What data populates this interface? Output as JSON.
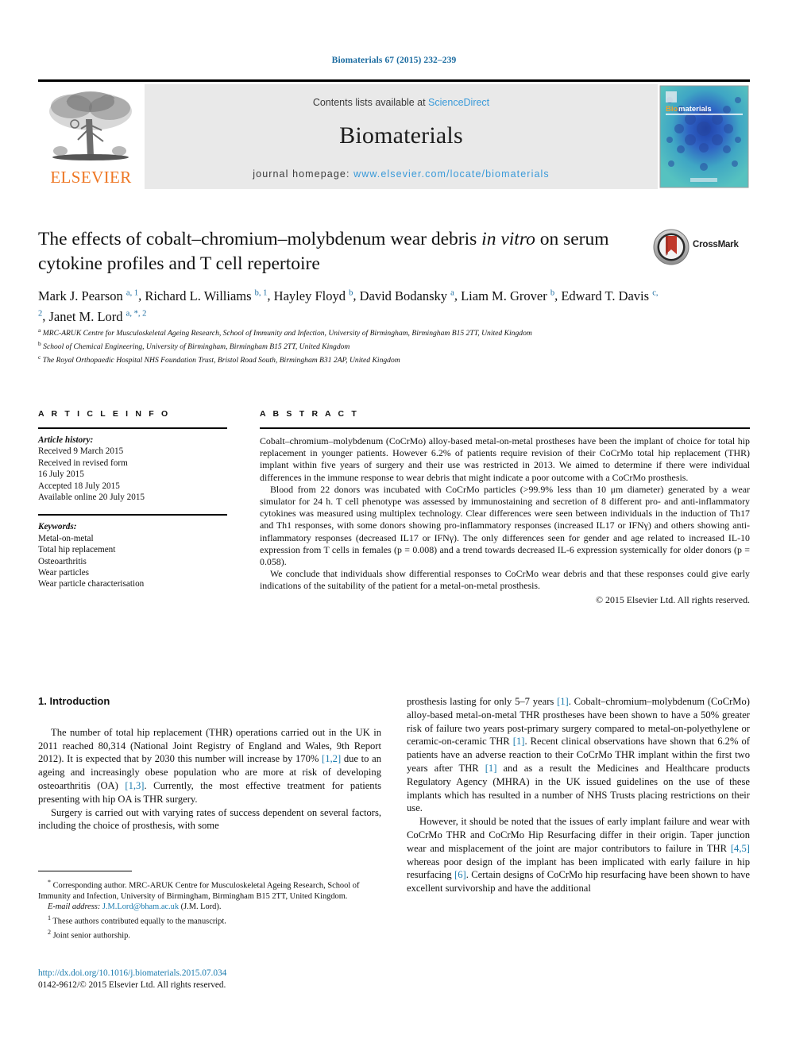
{
  "running_head": "Biomaterials 67 (2015) 232–239",
  "masthead": {
    "publisher_name": "ELSEVIER",
    "contents_prefix": "Contents lists available at ",
    "contents_link": "ScienceDirect",
    "journal_name": "Biomaterials",
    "homepage_prefix": "journal homepage: ",
    "homepage_url": "www.elsevier.com/locate/biomaterials",
    "cover_title_bio": "Bio",
    "cover_title_materials": "materials"
  },
  "article": {
    "title_line1_a": "The effects of cobalt",
    "title_full": "The effects of cobalt–chromium–molybdenum wear debris in vitro on serum cytokine profiles and T cell repertoire",
    "title_part1": "The effects of cobalt–chromium–molybdenum wear debris ",
    "title_italic": "in vitro",
    "title_part2": " on serum cytokine profiles and T cell repertoire",
    "crossmark_label": "CrossMark",
    "authors": [
      {
        "name": "Mark J. Pearson",
        "marks": "a, 1"
      },
      {
        "name": "Richard L. Williams",
        "marks": "b, 1"
      },
      {
        "name": "Hayley Floyd",
        "marks": "b"
      },
      {
        "name": "David Bodansky",
        "marks": "a"
      },
      {
        "name": "Liam M. Grover",
        "marks": "b"
      },
      {
        "name": "Edward T. Davis",
        "marks": "c, 2"
      },
      {
        "name": "Janet M. Lord",
        "marks": "a, *, 2"
      }
    ],
    "affiliations": [
      {
        "mark": "a",
        "text": "MRC-ARUK Centre for Musculoskeletal Ageing Research, School of Immunity and Infection, University of Birmingham, Birmingham B15 2TT, United Kingdom"
      },
      {
        "mark": "b",
        "text": "School of Chemical Engineering, University of Birmingham, Birmingham B15 2TT, United Kingdom"
      },
      {
        "mark": "c",
        "text": "The Royal Orthopaedic Hospital NHS Foundation Trust, Bristol Road South, Birmingham B31 2AP, United Kingdom"
      }
    ]
  },
  "article_info": {
    "heading": "A R T I C L E   I N F O",
    "history_label": "Article history:",
    "history": [
      "Received 9 March 2015",
      "Received in revised form",
      "16 July 2015",
      "Accepted 18 July 2015",
      "Available online 20 July 2015"
    ],
    "keywords_label": "Keywords:",
    "keywords": [
      "Metal-on-metal",
      "Total hip replacement",
      "Osteoarthritis",
      "Wear particles",
      "Wear particle characterisation"
    ]
  },
  "abstract": {
    "heading": "A B S T R A C T",
    "paragraphs": [
      "Cobalt–chromium–molybdenum (CoCrMo) alloy-based metal-on-metal prostheses have been the implant of choice for total hip replacement in younger patients. However 6.2% of patients require revision of their CoCrMo total hip replacement (THR) implant within five years of surgery and their use was restricted in 2013. We aimed to determine if there were individual differences in the immune response to wear debris that might indicate a poor outcome with a CoCrMo prosthesis.",
      "Blood from 22 donors was incubated with CoCrMo particles (>99.9% less than 10 μm diameter) generated by a wear simulator for 24 h. T cell phenotype was assessed by immunostaining and secretion of 8 different pro- and anti-inflammatory cytokines was measured using multiplex technology. Clear differences were seen between individuals in the induction of Th17 and Th1 responses, with some donors showing pro-inflammatory responses (increased IL17 or IFNγ) and others showing anti-inflammatory responses (decreased IL17 or IFNγ). The only differences seen for gender and age related to increased IL-10 expression from T cells in females (p = 0.008) and a trend towards decreased IL-6 expression systemically for older donors (p = 0.058).",
      "We conclude that individuals show differential responses to CoCrMo wear debris and that these responses could give early indications of the suitability of the patient for a metal-on-metal prosthesis."
    ],
    "copyright": "© 2015 Elsevier Ltd. All rights reserved."
  },
  "introduction": {
    "heading": "1.  Introduction",
    "left_paragraph_1_pre": "The number of total hip replacement (THR) operations carried out in the UK in 2011 reached 80,314 (National Joint Registry of England and Wales, 9th Report 2012). It is expected that by 2030 this number will increase by 170% ",
    "ref_1_2": "[1,2]",
    "left_paragraph_1_mid": " due to an ageing and increasingly obese population who are more at risk of developing osteoarthritis (OA) ",
    "ref_1_3": "[1,3]",
    "left_paragraph_1_post": ". Currently, the most effective treatment for patients presenting with hip OA is THR surgery.",
    "left_paragraph_2": "Surgery is carried out with varying rates of success dependent on several factors, including the choice of prosthesis, with some",
    "right_paragraph_1_pre": "prosthesis lasting for only 5–7 years ",
    "ref_1_a": "[1]",
    "right_paragraph_1_mid1": ". Cobalt–chromium–molybdenum (CoCrMo) alloy-based metal-on-metal THR prostheses have been shown to have a 50% greater risk of failure two years post-primary surgery compared to metal-on-polyethylene or ceramic-on-ceramic THR ",
    "ref_1_b": "[1]",
    "right_paragraph_1_mid2": ". Recent clinical observations have shown that 6.2% of patients have an adverse reaction to their CoCrMo THR implant within the first two years after THR ",
    "ref_1_c": "[1]",
    "right_paragraph_1_post": " and as a result the Medicines and Healthcare products Regulatory Agency (MHRA) in the UK issued guidelines on the use of these implants which has resulted in a number of NHS Trusts placing restrictions on their use.",
    "right_paragraph_2_pre": "However, it should be noted that the issues of early implant failure and wear with CoCrMo THR and CoCrMo Hip Resurfacing differ in their origin. Taper junction wear and misplacement of the joint are major contributors to failure in THR ",
    "ref_4_5": "[4,5]",
    "right_paragraph_2_mid": " whereas poor design of the implant has been implicated with early failure in hip resurfacing ",
    "ref_6": "[6]",
    "right_paragraph_2_post": ". Certain designs of CoCrMo hip resurfacing have been shown to have excellent survivorship and have the additional"
  },
  "footnotes": {
    "corresponding": "Corresponding author. MRC-ARUK Centre for Musculoskeletal Ageing Research, School of Immunity and Infection, University of Birmingham, Birmingham B15 2TT, United Kingdom.",
    "email_label": "E-mail address:",
    "email": "J.M.Lord@bham.ac.uk",
    "email_owner": "(J.M. Lord).",
    "note_1": "These authors contributed equally to the manuscript.",
    "note_2": "Joint senior authorship.",
    "doi": "http://dx.doi.org/10.1016/j.biomaterials.2015.07.034",
    "issn_copyright": "0142-9612/© 2015 Elsevier Ltd. All rights reserved."
  },
  "colors": {
    "link_blue": "#1a7aad",
    "sciencedirect_blue": "#3a9ad9",
    "elsevier_orange": "#ee7623",
    "masthead_grey": "#e9e9e9"
  }
}
